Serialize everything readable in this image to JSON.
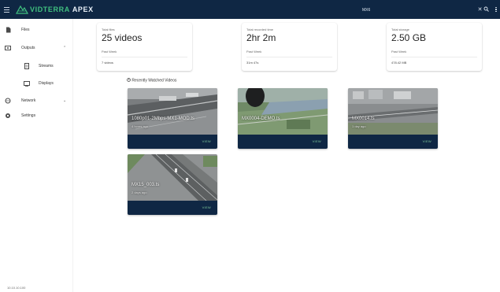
{
  "app": {
    "brand": "VIDTERRA",
    "brand_suffix": "APEX",
    "accent_color": "#3fbf7f",
    "bar_color": "#0f2744"
  },
  "search": {
    "value": "MX6",
    "icon_clear": "close-icon",
    "icon_search": "search-icon",
    "icon_more": "more-vert-icon"
  },
  "sidebar": {
    "items": [
      {
        "label": "Files",
        "icon": "file-icon"
      },
      {
        "label": "Outputs",
        "icon": "outputs-icon"
      },
      {
        "label": "Streams",
        "icon": "stream-icon"
      },
      {
        "label": "Displays",
        "icon": "display-icon"
      },
      {
        "label": "Network",
        "icon": "network-icon"
      },
      {
        "label": "Settings",
        "icon": "gear-icon"
      }
    ],
    "ip": "10.10.10.100"
  },
  "stats": [
    {
      "label": "Total files",
      "value": "25 videos",
      "period": "Past Week",
      "delta": "7 videos"
    },
    {
      "label": "Total recorded time",
      "value": "2hr 2m",
      "period": "Past Week",
      "delta": "31m 47s"
    },
    {
      "label": "Total storage",
      "value": "2.50 GB",
      "period": "Past Week",
      "delta": "478.42 MB"
    }
  ],
  "recent": {
    "title": "Recently Watched Videos",
    "icon": "history-icon",
    "videos": [
      {
        "name": "1080p01-2Mbps-MX1-MOD.ts",
        "time": "4 hours ago",
        "view": "VIEW"
      },
      {
        "name": "MX0004-DEMO.ts",
        "time": "",
        "view": "VIEW"
      },
      {
        "name": "MX0014.ts",
        "time": "1 day ago",
        "view": "VIEW"
      },
      {
        "name": "MX15_003.ts",
        "time": "2 days ago",
        "view": "VIEW"
      }
    ]
  }
}
